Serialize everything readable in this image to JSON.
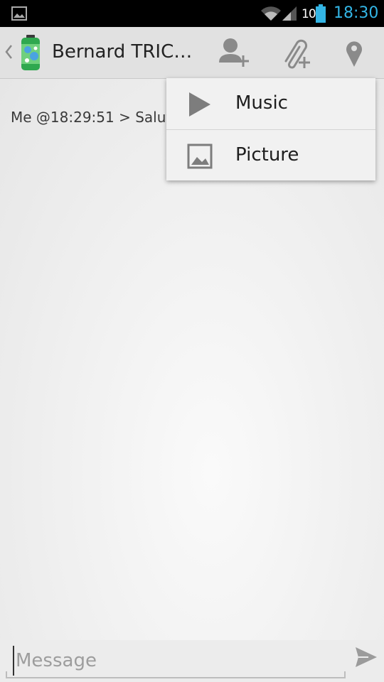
{
  "status_bar": {
    "battery_percent": "100",
    "time": "18:30"
  },
  "action_bar": {
    "title": "Bernard TRIC…",
    "actions": [
      "add-contact",
      "attach",
      "location"
    ]
  },
  "chat": {
    "messages": [
      {
        "text": "Me @18:29:51 > Salut"
      }
    ]
  },
  "composer": {
    "placeholder": "Message",
    "value": ""
  },
  "attach_menu": {
    "items": [
      {
        "label": "Music",
        "icon": "play-icon"
      },
      {
        "label": "Picture",
        "icon": "picture-icon"
      }
    ]
  },
  "colors": {
    "clock": "#33b5e5",
    "action_bar": "#e1e1e1",
    "icon_gray": "#8a8a8a"
  }
}
